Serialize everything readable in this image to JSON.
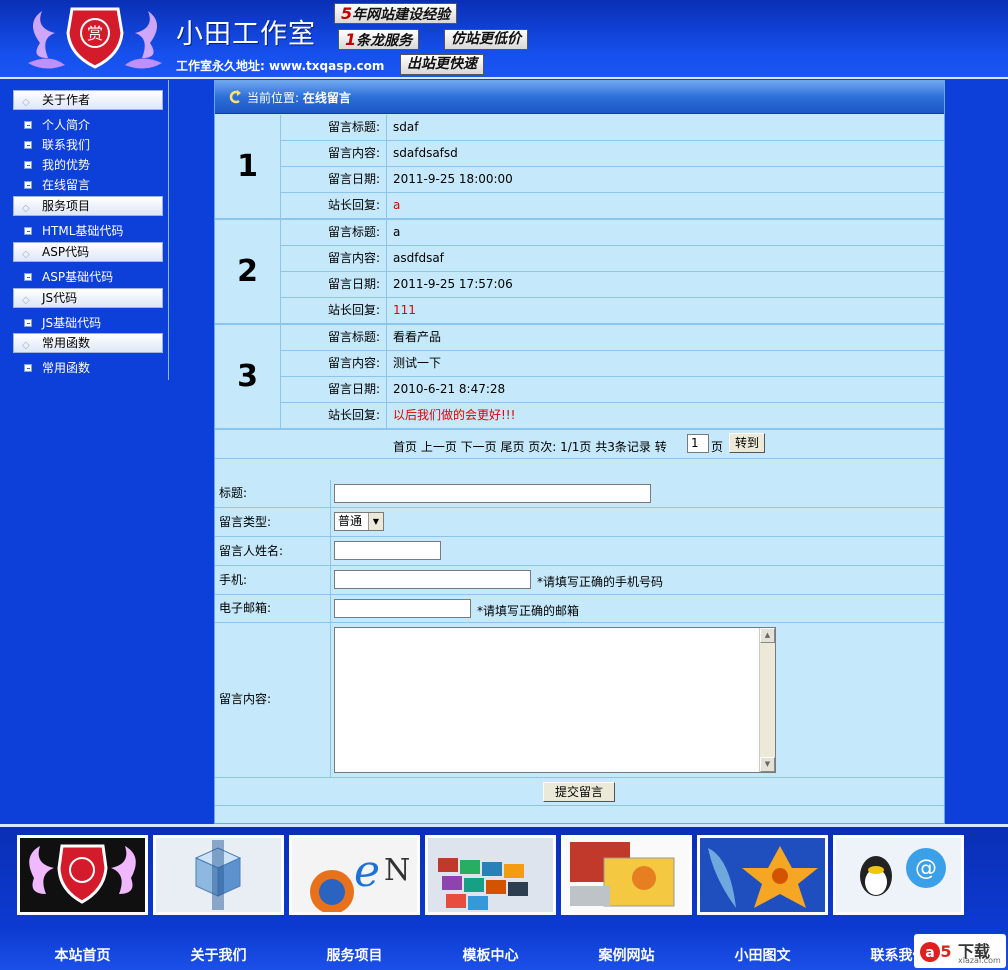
{
  "header": {
    "site_name": "小田工作室",
    "address": "工作室永久地址: www.txqasp.com",
    "slogans": [
      {
        "highlight": "5",
        "text": "年网站建设经验"
      },
      {
        "highlight": "1",
        "text": "条龙服务"
      },
      {
        "highlight": "",
        "text": "仿站更低价"
      },
      {
        "highlight": "",
        "text": "出站更快速"
      }
    ]
  },
  "sidebar": {
    "categories": [
      {
        "label": "关于作者",
        "items": [
          "个人简介",
          "联系我们",
          "我的优势",
          "在线留言"
        ]
      },
      {
        "label": "服务项目",
        "items": [
          "HTML基础代码"
        ]
      },
      {
        "label": "ASP代码",
        "items": [
          "ASP基础代码"
        ]
      },
      {
        "label": "JS代码",
        "items": [
          "JS基础代码"
        ]
      },
      {
        "label": "常用函数",
        "items": [
          "常用函数"
        ]
      }
    ]
  },
  "location": {
    "prefix": "当前位置:",
    "page": "在线留言"
  },
  "field_labels": {
    "title": "留言标题:",
    "content": "留言内容:",
    "date": "留言日期:",
    "reply": "站长回复:"
  },
  "entries": [
    {
      "number": "1",
      "title": "sdaf",
      "content": "sdafdsafsd",
      "date": "2011-9-25 18:00:00",
      "reply": "a"
    },
    {
      "number": "2",
      "title": "a",
      "content": "asdfdsaf",
      "date": "2011-9-25 17:57:06",
      "reply": "111"
    },
    {
      "number": "3",
      "title": "看看产品",
      "content": "测试一下",
      "date": "2010-6-21 8:47:28",
      "reply": "以后我们做的会更好!!!"
    }
  ],
  "pager": {
    "text": "首页  上一页  下一页  尾页  页次: 1/1页  共3条记录  转",
    "page_value": "1",
    "unit": "页",
    "go_label": "转到"
  },
  "form": {
    "title_label": "标题:",
    "type_label": "留言类型:",
    "type_value": "普通",
    "name_label": "留言人姓名:",
    "phone_label": "手机:",
    "phone_hint": "*请填写正确的手机号码",
    "email_label": "电子邮箱:",
    "email_hint": "*请填写正确的邮箱",
    "content_label": "留言内容:",
    "submit_label": "提交留言"
  },
  "footer_nav": [
    {
      "label": "本站首页",
      "icon": "home-emblem-icon"
    },
    {
      "label": "关于我们",
      "icon": "cubes-icon"
    },
    {
      "label": "服务项目",
      "icon": "browsers-icon"
    },
    {
      "label": "模板中心",
      "icon": "templates-icon"
    },
    {
      "label": "案例网站",
      "icon": "cases-icon"
    },
    {
      "label": "小田图文",
      "icon": "flower-feather-icon"
    },
    {
      "label": "联系我们",
      "icon": "qq-contact-icon"
    }
  ],
  "watermark": {
    "text": "下载",
    "url": "xiazai.com",
    "mark": "a5"
  },
  "colors": {
    "background": "#0d3fd9",
    "panel": "#c5e9fb",
    "reply_red": "#e00000",
    "location_bar": "#2d6fd8"
  }
}
